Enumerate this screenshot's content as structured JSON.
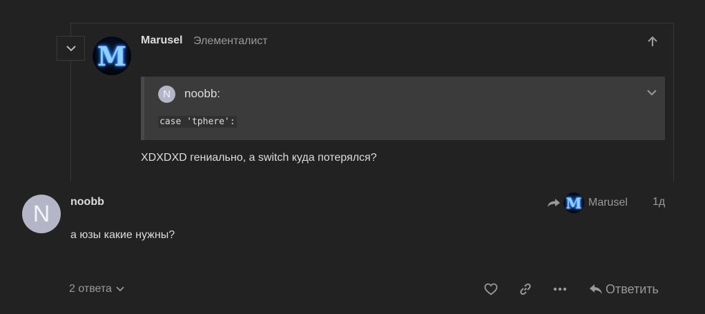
{
  "embedded_post": {
    "username": "Marusel",
    "user_title": "Элементалист",
    "avatar_letter": "M",
    "quote": {
      "avatar_letter": "N",
      "username": "noobb:",
      "code": "case 'tphere':"
    },
    "text": "XDXDXD гениально, а switch куда потерялся?"
  },
  "post": {
    "avatar_letter": "N",
    "username": "noobb",
    "reply_to": {
      "avatar_letter": "M",
      "username": "Marusel"
    },
    "date": "1д",
    "text": "а юзы какие нужны?"
  },
  "footer": {
    "replies_label": "2 ответа",
    "reply_button_label": "Ответить"
  },
  "icons": {
    "collapse": "chevron-down-icon",
    "up": "arrow-up-icon",
    "quote_toggle": "chevron-down-icon",
    "reply_to": "share-arrow-icon",
    "like": "heart-icon",
    "link": "link-icon",
    "more": "ellipsis-icon",
    "reply": "reply-arrow-icon"
  },
  "colors": {
    "background": "#222222",
    "quote_background": "#3b3b3b",
    "text_primary": "#dddddd",
    "text_muted": "#9a9a9a",
    "letter_avatar": "#b5b5c8"
  }
}
